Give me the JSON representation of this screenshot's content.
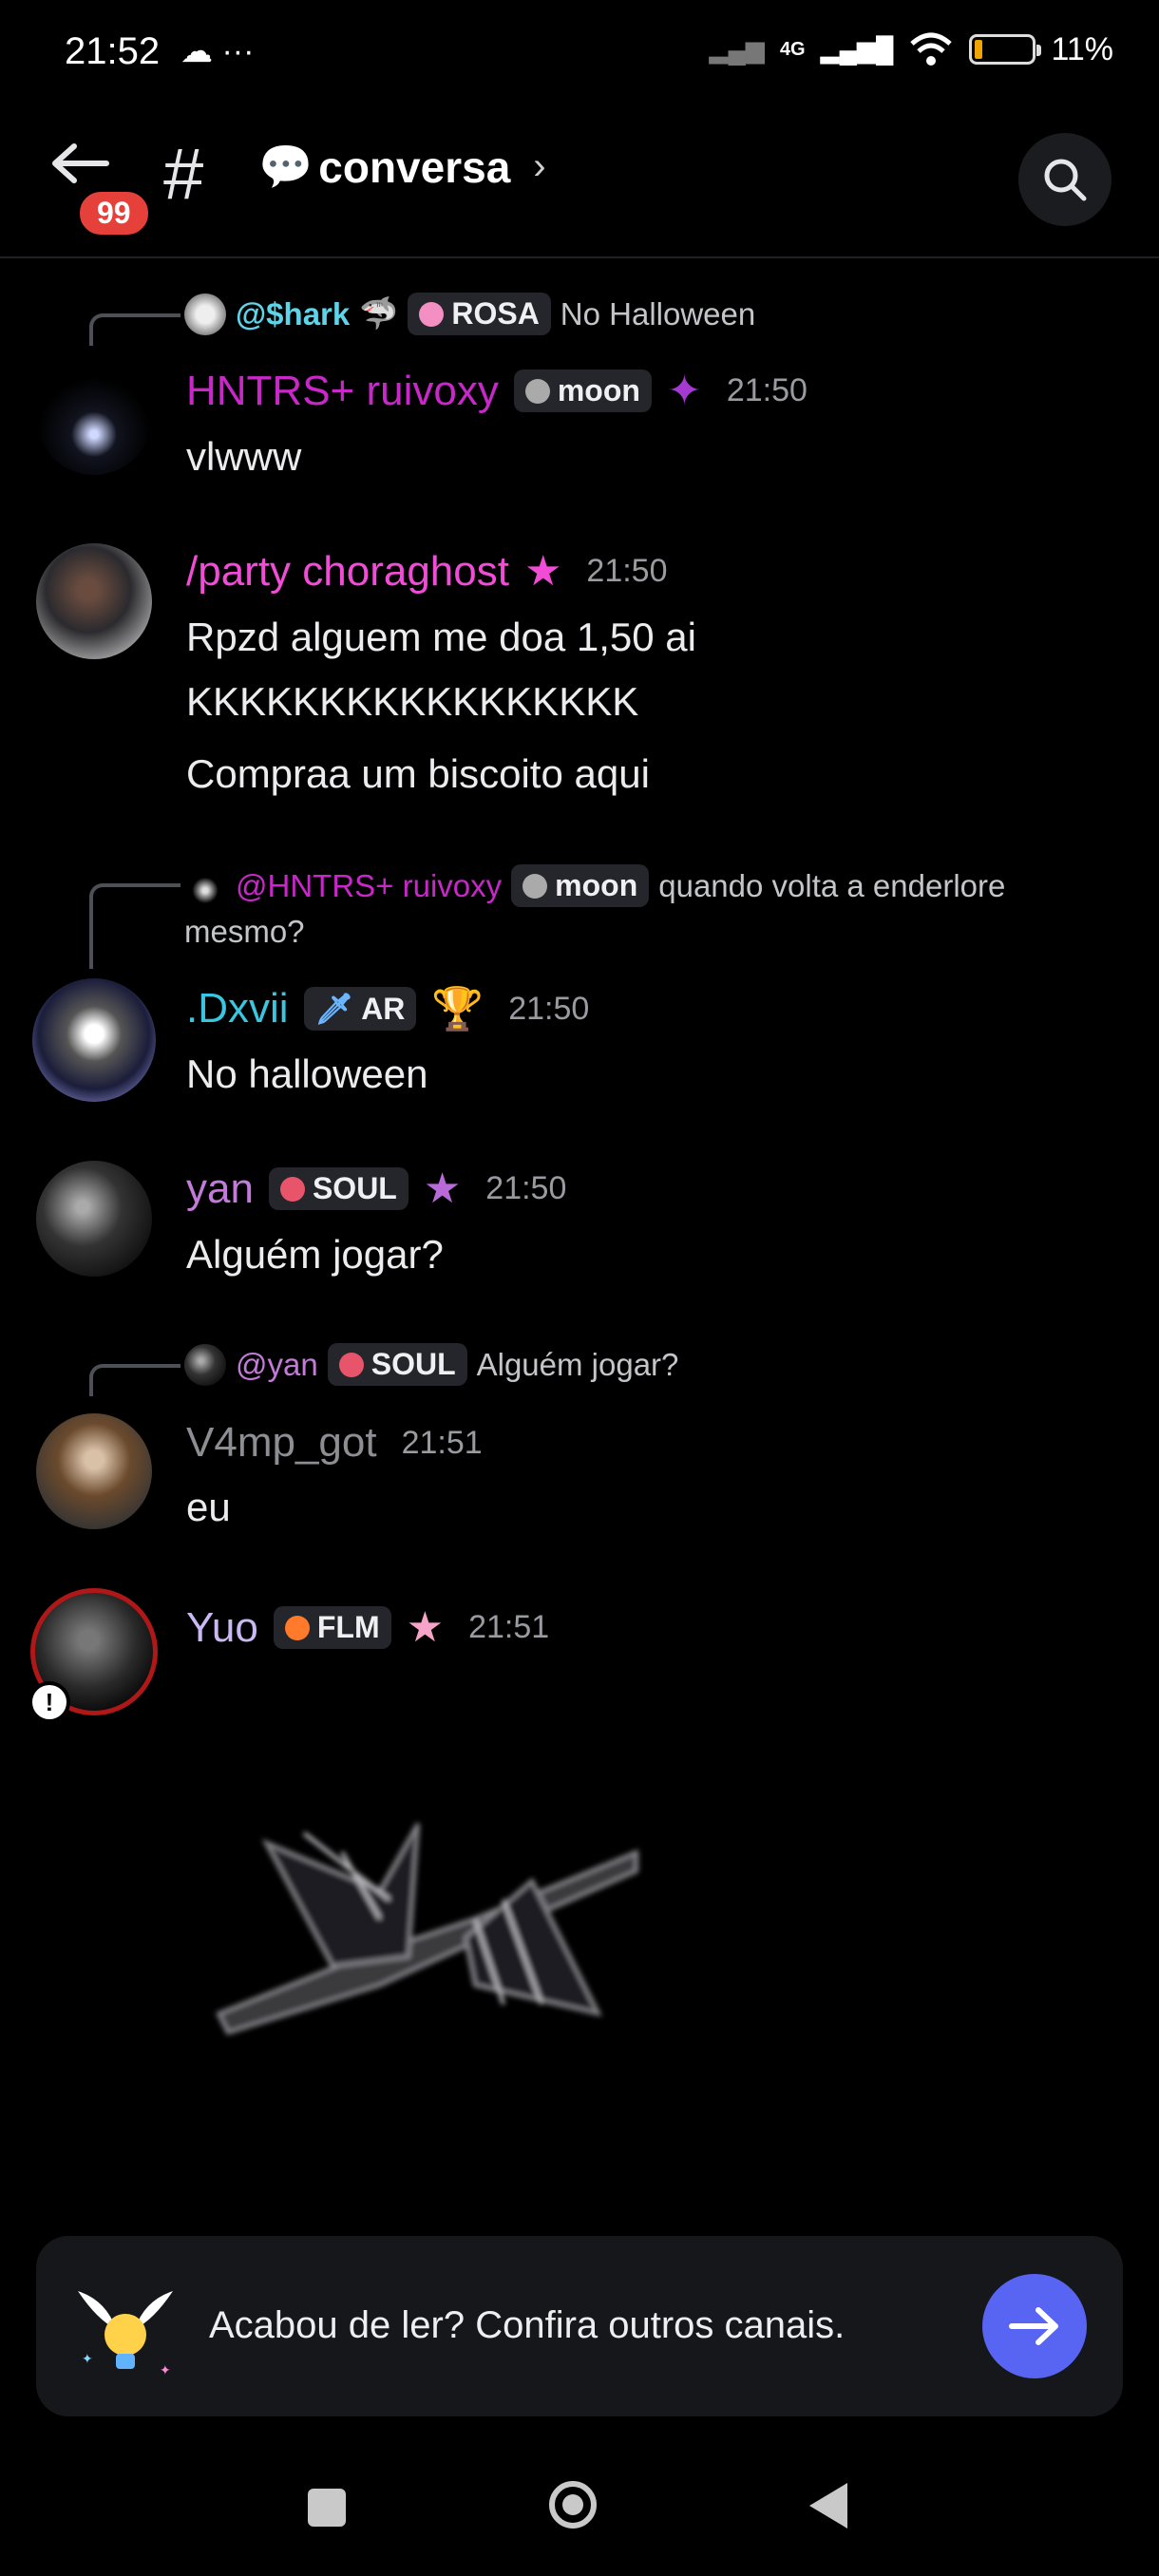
{
  "status_bar": {
    "time": "21:52",
    "left_icons": "☁ ···",
    "network": "4G",
    "battery": "11%"
  },
  "header": {
    "unread_badge": "99",
    "hash": "#",
    "channel_icon": "💬",
    "channel_name": "conversa",
    "chevron": "›"
  },
  "messages": [
    {
      "reply": {
        "author": "@$hark",
        "author_emoji": "🦈",
        "role": "ROSA",
        "text": "No Halloween"
      },
      "author": "HNTRS+ ruivoxy",
      "role": "moon",
      "time": "21:50",
      "lines": [
        "vlwww"
      ]
    },
    {
      "author": "/party choraghost",
      "time": "21:50",
      "lines": [
        "Rpzd alguem me doa 1,50 ai",
        "KKKKKKKKKKKKKKKKK",
        "Compraa um biscoito aqui"
      ]
    },
    {
      "reply": {
        "author": "@HNTRS+ ruivoxy",
        "role": "moon",
        "text": "quando volta a enderlore",
        "text2": "mesmo?"
      },
      "author": ".Dxvii",
      "role": "AR",
      "time": "21:50",
      "lines": [
        "No halloween"
      ]
    },
    {
      "author": "yan",
      "role": "SOUL",
      "time": "21:50",
      "lines": [
        "Alguém jogar?"
      ]
    },
    {
      "reply": {
        "author": "@yan",
        "role": "SOUL",
        "text": "Alguém jogar?"
      },
      "author": "V4mp_got",
      "time": "21:51",
      "lines": [
        "eu"
      ]
    },
    {
      "author": "Yuo",
      "role": "FLM",
      "time": "21:51",
      "lines": []
    }
  ],
  "bottom_card": {
    "text": "Acabou de ler? Confira outros canais."
  },
  "colors": {
    "accent": "#5865f2",
    "badge": "#e5403a"
  }
}
